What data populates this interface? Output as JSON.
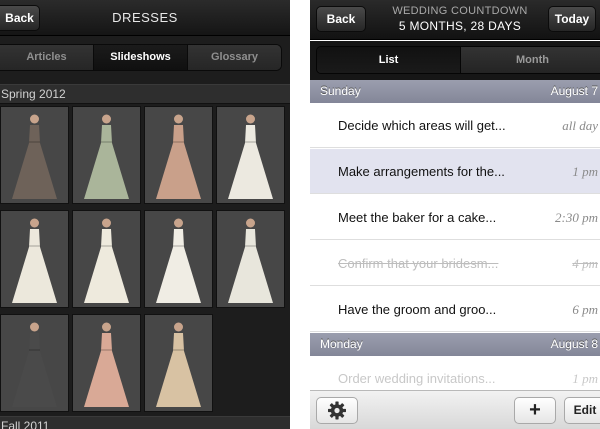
{
  "dresses_app": {
    "back_label": "Back",
    "title": "DRESSES",
    "tabs": [
      "Articles",
      "Slideshows",
      "Glossary"
    ],
    "active_tab": "Slideshows",
    "sections": [
      "Spring 2012",
      "Fall 2011"
    ],
    "thumbnails": [
      {
        "color": "#6e6259"
      },
      {
        "color": "#aab59a"
      },
      {
        "color": "#c9a08a"
      },
      {
        "color": "#ece9e0"
      },
      {
        "color": "#ece8dc"
      },
      {
        "color": "#eeeadd"
      },
      {
        "color": "#f0ede4"
      },
      {
        "color": "#e8e6dc"
      },
      {
        "color": "#4a4a4a"
      },
      {
        "color": "#d9a996"
      },
      {
        "color": "#d8c2a3"
      }
    ]
  },
  "countdown_app": {
    "back_label": "Back",
    "title_line1": "WEDDING COUNTDOWN",
    "title_line2": "5 MONTHS, 28 DAYS",
    "today_label": "Today",
    "tabs": [
      "List",
      "Month"
    ],
    "active_tab": "List",
    "days": [
      {
        "name": "Sunday",
        "date": "August 7",
        "tasks": [
          {
            "text": "Decide which areas will get...",
            "time": "all day",
            "state": "normal"
          },
          {
            "text": "Make arrangements for the...",
            "time": "1 pm",
            "state": "selected"
          },
          {
            "text": "Meet the baker for a cake...",
            "time": "2:30 pm",
            "state": "normal"
          },
          {
            "text": "Confirm that your bridesm...",
            "time": "4 pm",
            "state": "done"
          },
          {
            "text": "Have the groom and groo...",
            "time": "6 pm",
            "state": "normal"
          }
        ]
      },
      {
        "name": "Monday",
        "date": "August 8",
        "tasks": [
          {
            "text": "Order wedding invitations...",
            "time": "1 pm",
            "state": "faded"
          }
        ]
      }
    ],
    "toolbar": {
      "settings_icon": "gear-icon",
      "add_label": "+",
      "edit_label": "Edit"
    }
  }
}
